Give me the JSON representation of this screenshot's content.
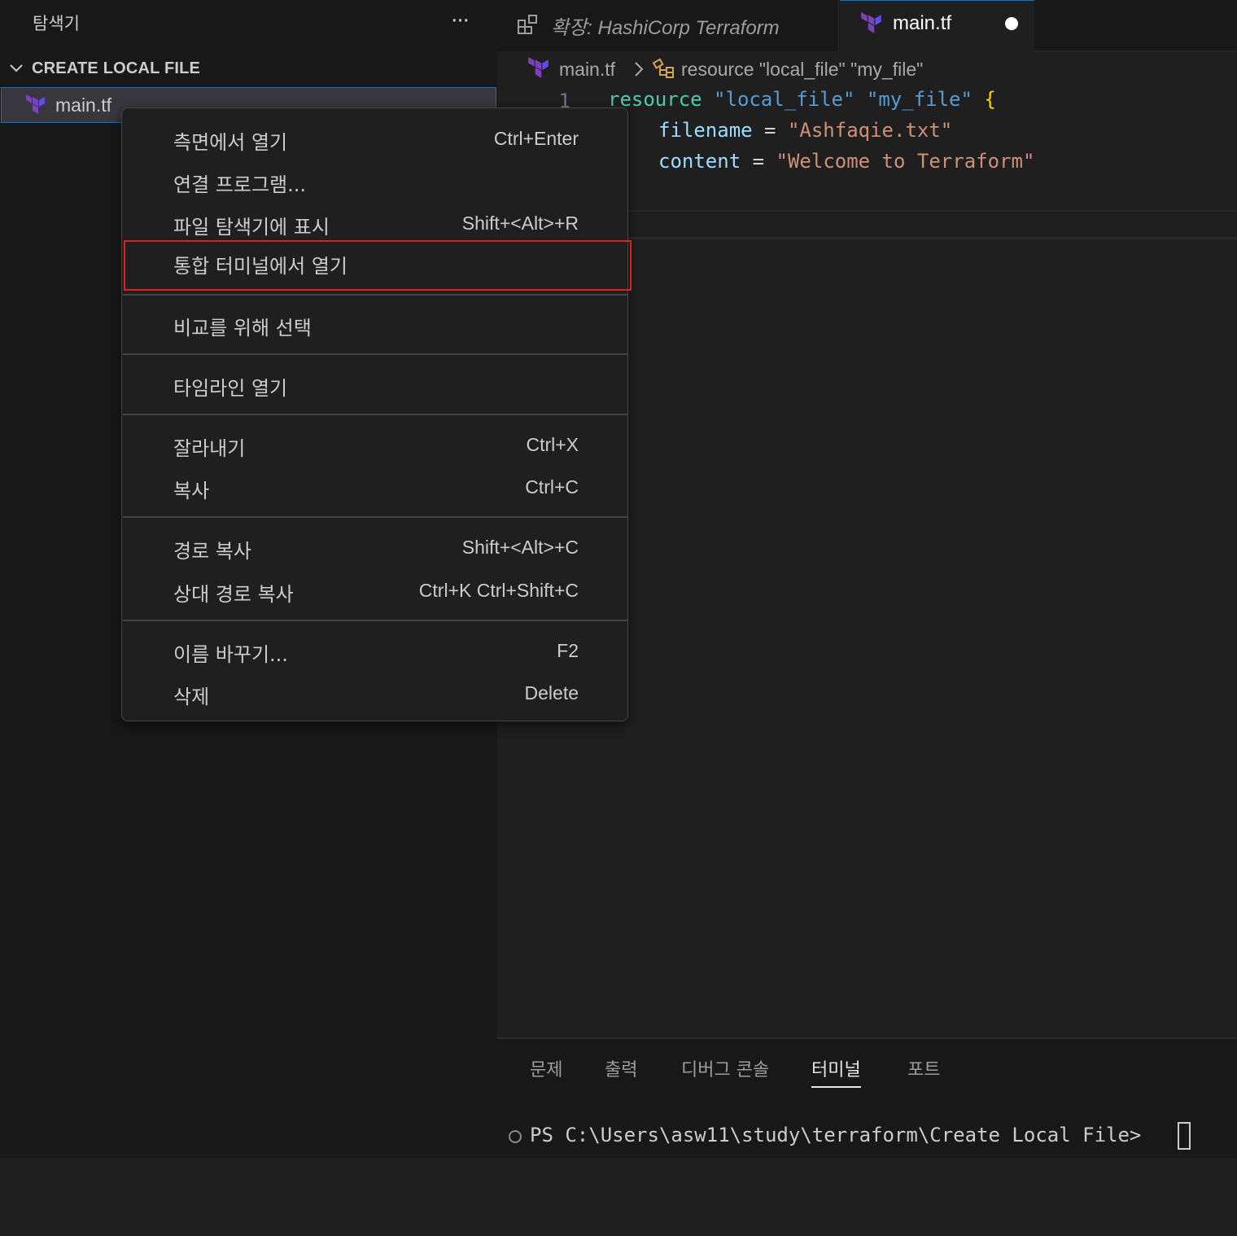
{
  "sidebar": {
    "title": "탐색기",
    "more_icon": "ellipsis-icon",
    "section_title": "CREATE LOCAL FILE",
    "file_label": "main.tf"
  },
  "tabs": [
    {
      "label": "확장: HashiCorp Terraform",
      "icon": "extensions-icon",
      "italic": true
    },
    {
      "label": "main.tf",
      "icon": "terraform-icon",
      "dirty": true,
      "active": true
    }
  ],
  "breadcrumb": {
    "file": "main.tf",
    "symbol": "resource \"local_file\" \"my_file\""
  },
  "editor": {
    "line_numbers": [
      "1"
    ],
    "line1": {
      "keyword": "resource",
      "type": "\"local_file\"",
      "name": "\"my_file\"",
      "brace": "{"
    },
    "line2": {
      "attr": "filename",
      "op": "=",
      "value": "\"Ashfaqie.txt\""
    },
    "line3": {
      "attr": "content",
      "op": "=",
      "value": "\"Welcome to Terraform\""
    }
  },
  "context_menu": {
    "items": [
      {
        "label": "측면에서 열기",
        "shortcut": "Ctrl+Enter"
      },
      {
        "label": "연결 프로그램...",
        "shortcut": ""
      },
      {
        "label": "파일 탐색기에 표시",
        "shortcut": "Shift+<Alt>+R"
      },
      {
        "label": "통합 터미널에서 열기",
        "shortcut": "",
        "highlighted": true
      },
      {
        "label": "비교를 위해 선택",
        "shortcut": ""
      },
      {
        "label": "타임라인 열기",
        "shortcut": ""
      },
      {
        "label": "잘라내기",
        "shortcut": "Ctrl+X"
      },
      {
        "label": "복사",
        "shortcut": "Ctrl+C"
      },
      {
        "label": "경로 복사",
        "shortcut": "Shift+<Alt>+C"
      },
      {
        "label": "상대 경로 복사",
        "shortcut": "Ctrl+K Ctrl+Shift+C"
      },
      {
        "label": "이름 바꾸기...",
        "shortcut": "F2"
      },
      {
        "label": "삭제",
        "shortcut": "Delete"
      }
    ]
  },
  "panel": {
    "tabs": [
      "문제",
      "출력",
      "디버그 콘솔",
      "터미널",
      "포트"
    ],
    "active_tab": "터미널",
    "terminal_prompt": "PS C:\\Users\\asw11\\study\\terraform\\Create Local File>"
  },
  "colors": {
    "accent": "#0078d4",
    "terraform_purple": "#7b42bc",
    "highlight_border": "#e02020"
  }
}
